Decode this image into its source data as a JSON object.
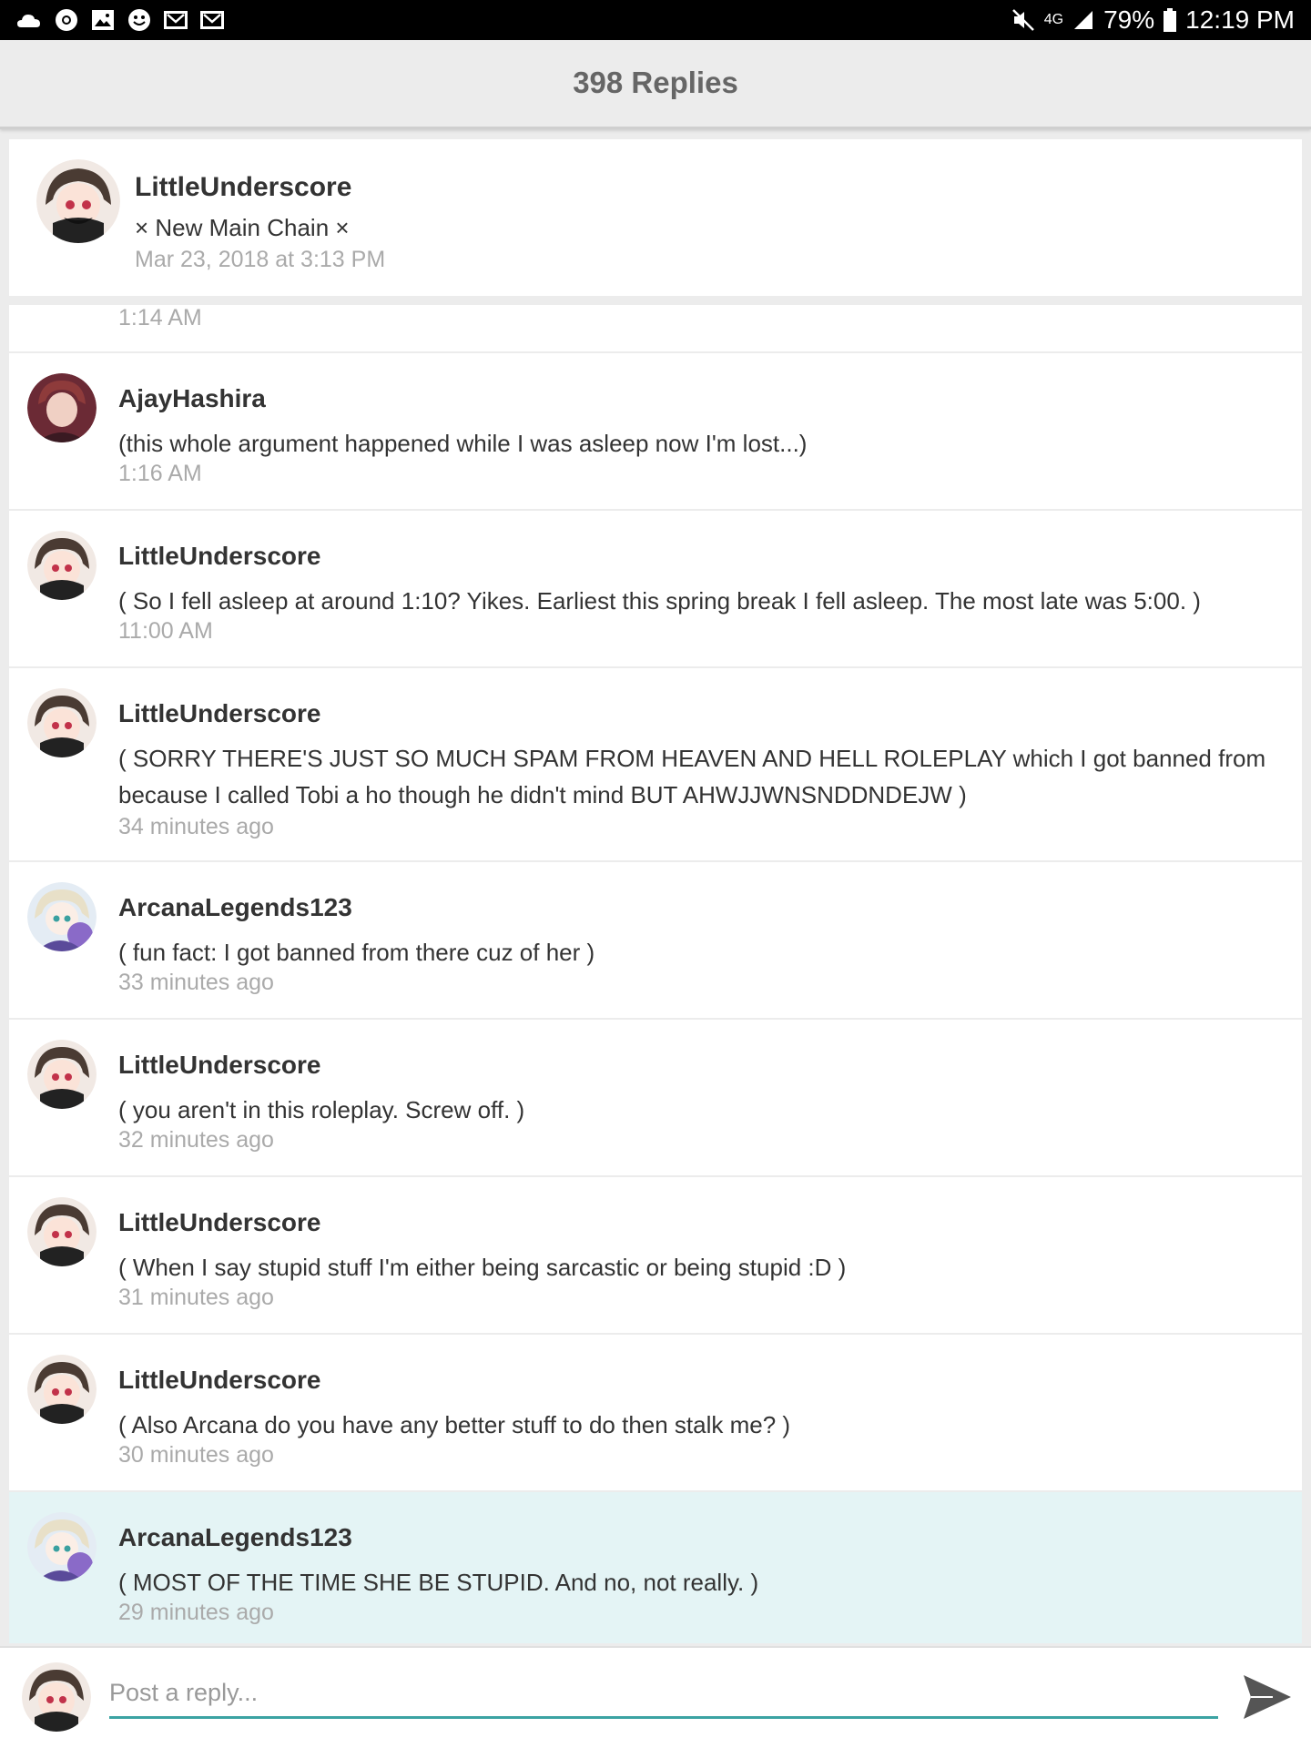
{
  "status_bar": {
    "left_icons": [
      "cloud-icon",
      "chrome-icon",
      "image-icon",
      "smiley-icon",
      "mail-icon",
      "mail-icon"
    ],
    "network": "4G",
    "battery": "79%",
    "time": "12:19 PM"
  },
  "header": {
    "title": "398 Replies"
  },
  "original_post": {
    "author": "LittleUnderscore",
    "subject": "× New Main Chain ×",
    "date": "Mar 23, 2018 at 3:13 PM"
  },
  "replies": [
    {
      "partial": true,
      "time": "1:14 AM"
    },
    {
      "author": "AjayHashira",
      "avatar": "ajay",
      "message": "(this whole argument happened while I was asleep now I'm lost...)",
      "time": "1:16 AM"
    },
    {
      "author": "LittleUnderscore",
      "avatar": "little",
      "message": "( So I fell asleep at around 1:10? Yikes. Earliest this spring break I fell asleep. The most late was 5:00. )",
      "time": "11:00 AM"
    },
    {
      "author": "LittleUnderscore",
      "avatar": "little",
      "message": "( SORRY THERE'S JUST SO MUCH SPAM FROM HEAVEN AND HELL ROLEPLAY which I got banned from because I called Tobi a ho though he didn't mind BUT AHWJJWNSNDDNDEJW )",
      "time": "34 minutes ago"
    },
    {
      "author": "ArcanaLegends123",
      "avatar": "arcana",
      "message": "( fun fact: I got banned from there cuz of her )",
      "time": "33 minutes ago"
    },
    {
      "author": "LittleUnderscore",
      "avatar": "little",
      "message": "( you aren't in this roleplay. Screw off. )",
      "time": "32 minutes ago"
    },
    {
      "author": "LittleUnderscore",
      "avatar": "little",
      "message": "( When I say stupid stuff I'm either being sarcastic or being stupid :D )",
      "time": "31 minutes ago"
    },
    {
      "author": "LittleUnderscore",
      "avatar": "little",
      "message": "( Also Arcana do you have any better stuff to do then stalk me? )",
      "time": "30 minutes ago"
    },
    {
      "author": "ArcanaLegends123",
      "avatar": "arcana",
      "message": "( MOST OF THE TIME SHE BE STUPID. And no, not really. )",
      "time": "29 minutes ago",
      "highlighted": true
    }
  ],
  "composer": {
    "placeholder": "Post a reply..."
  },
  "colors": {
    "accent": "#3ba3a3",
    "highlight_row": "#e4f4f5",
    "muted_text": "#aaaaaa"
  }
}
